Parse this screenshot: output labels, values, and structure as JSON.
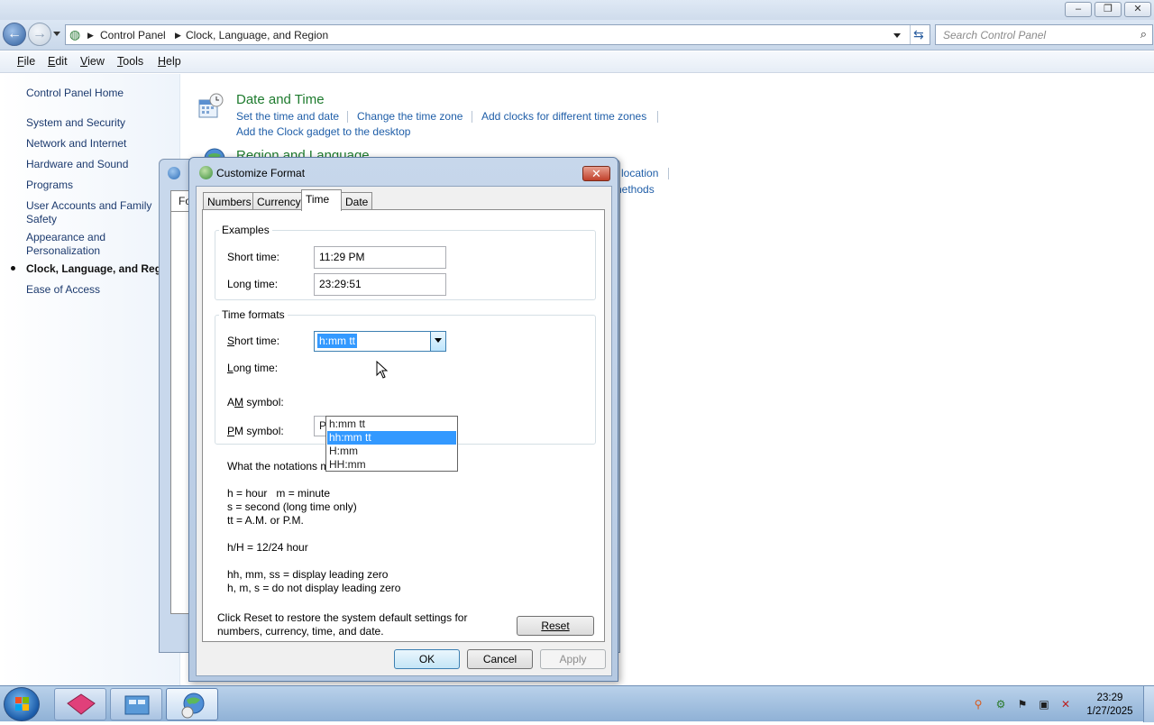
{
  "window": {
    "controls": [
      "–",
      "❐",
      "✕"
    ]
  },
  "address": {
    "crumbs": [
      "Control Panel",
      "Clock, Language, and Region"
    ],
    "search_placeholder": "Search Control Panel"
  },
  "menubar": [
    {
      "underline": "F",
      "rest": "ile"
    },
    {
      "underline": "E",
      "rest": "dit"
    },
    {
      "underline": "V",
      "rest": "iew"
    },
    {
      "underline": "T",
      "rest": "ools"
    },
    {
      "underline": "H",
      "rest": "elp"
    }
  ],
  "leftpane": {
    "home": "Control Panel Home",
    "items": [
      "System and Security",
      "Network and Internet",
      "Hardware and Sound",
      "Programs",
      "User Accounts and Family Safety",
      "Appearance and Personalization",
      "Clock, Language, and Region",
      "Ease of Access"
    ]
  },
  "main": {
    "datetime": {
      "title": "Date and Time",
      "links": [
        "Set the time and date",
        "Change the time zone",
        "Add clocks for different time zones",
        "Add the Clock gadget to the desktop"
      ]
    },
    "region": {
      "title": "Region and Language",
      "links_partial": [
        "location",
        "nethods"
      ]
    }
  },
  "background_dialog": {
    "tab_partial": "Fo"
  },
  "dialog": {
    "title": "Customize Format",
    "tabs": [
      "Numbers",
      "Currency",
      "Time",
      "Date"
    ],
    "active_tab": "Time",
    "examples": {
      "label": "Examples",
      "short_label": "Short time:",
      "short_value": "11:29 PM",
      "long_label": "Long time:",
      "long_value": "23:29:51"
    },
    "formats": {
      "label": "Time formats",
      "short_label_pre": "",
      "short_label_u": "S",
      "short_label_post": "hort time:",
      "short_value": "h:mm tt",
      "long_label_pre": "",
      "long_label_u": "L",
      "long_label_post": "ong time:",
      "am_label_pre": "A",
      "am_label_u": "M",
      "am_label_post": " symbol:",
      "pm_label_pre": "",
      "pm_label_u": "P",
      "pm_label_post": "M symbol:",
      "pm_value": "PM",
      "options": [
        "h:mm tt",
        "hh:mm tt",
        "H:mm",
        "HH:mm"
      ],
      "highlighted_option": "hh:mm tt"
    },
    "notes": {
      "heading": "What the notations mean:",
      "lines": [
        "h = hour   m = minute",
        "s = second (long time only)",
        "tt = A.M. or P.M.",
        "h/H = 12/24 hour",
        "hh, mm, ss = display leading zero",
        "h, m, s = do not display leading zero"
      ]
    },
    "reset_text": "Click Reset to restore the system default settings for numbers, currency, time, and date.",
    "reset_button": "Reset",
    "ok": "OK",
    "cancel": "Cancel",
    "apply": "Apply"
  },
  "taskbar": {
    "time": "23:29",
    "date": "1/27/2025"
  }
}
